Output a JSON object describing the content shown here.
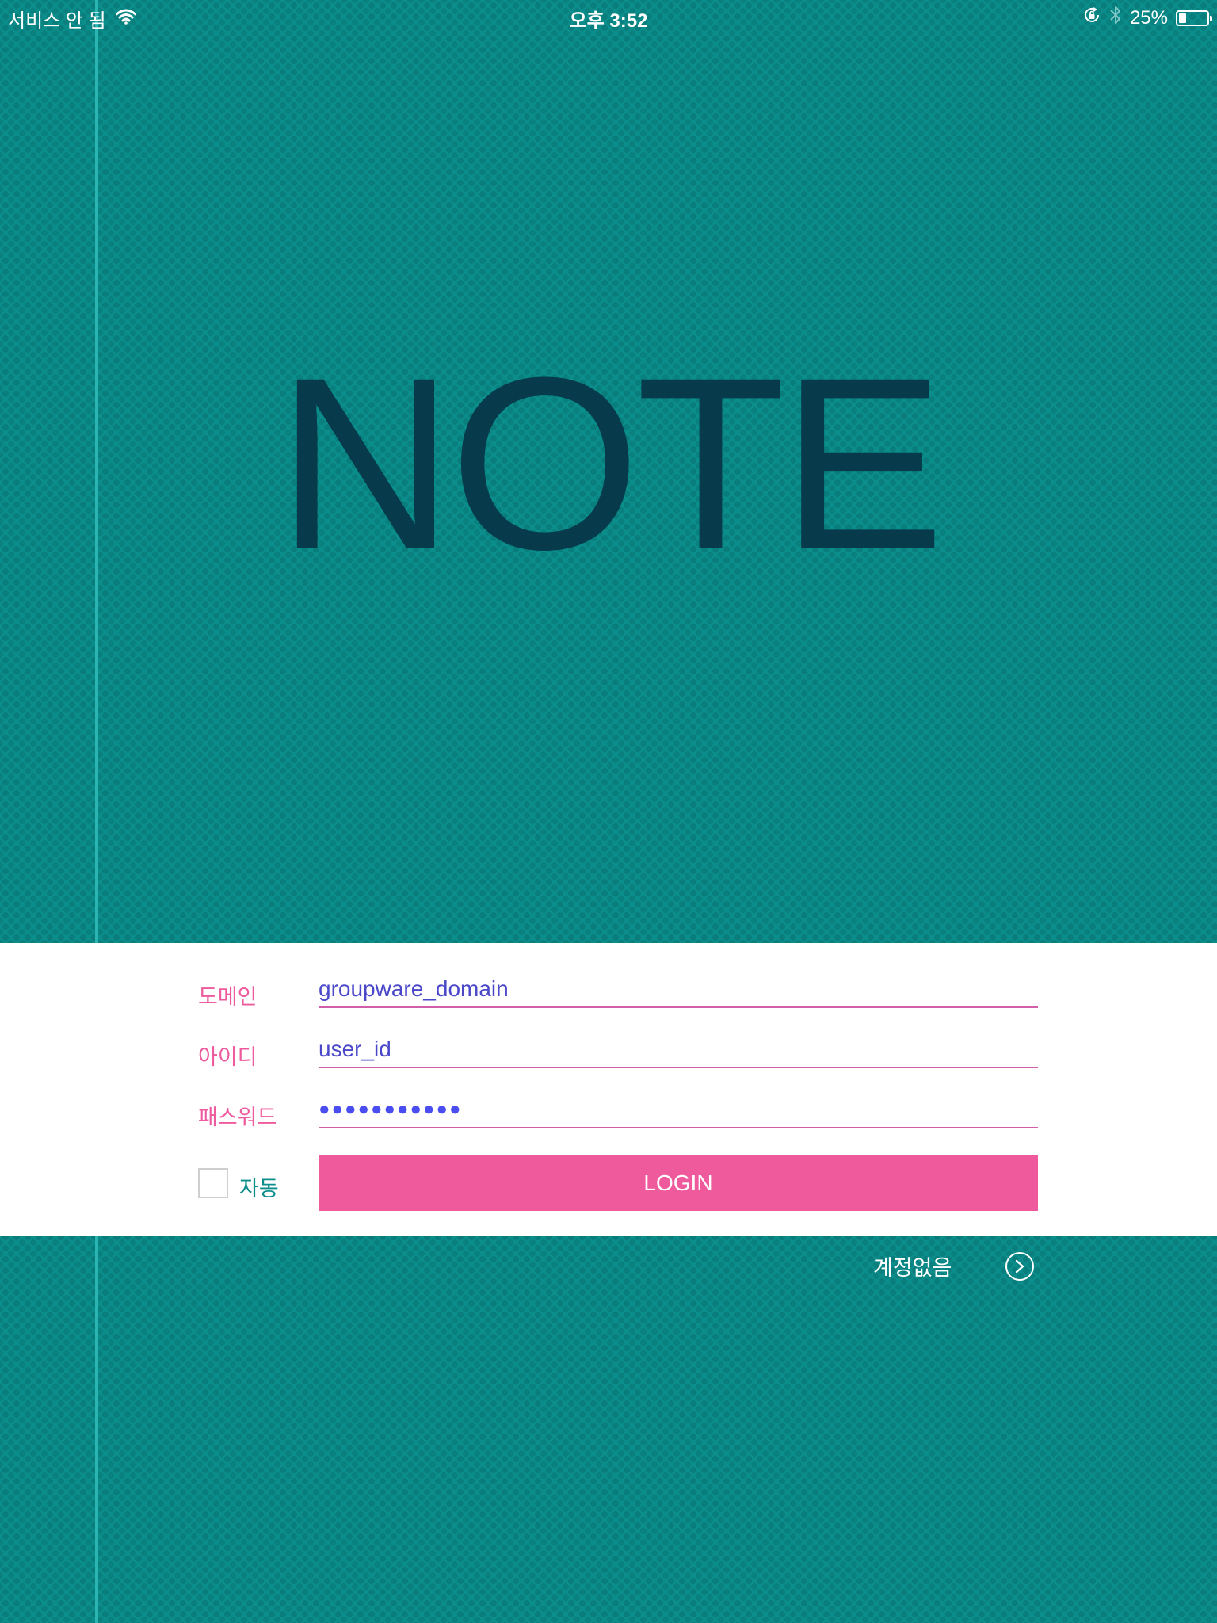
{
  "status_bar": {
    "carrier": "서비스 안 됨",
    "time": "오후 3:52",
    "battery_percent": "25%",
    "battery_level": 0.25,
    "icons": [
      "wifi-icon",
      "rotation-lock-icon",
      "bluetooth-icon",
      "battery-icon"
    ]
  },
  "logo": {
    "text": "NOTE"
  },
  "login": {
    "domain_label": "도메인",
    "domain_value": "groupware_domain",
    "id_label": "아이디",
    "id_value": "user_id",
    "password_label": "패스워드",
    "password_masked": "●●●●●●●●●●●",
    "auto_label": "자동",
    "auto_checked": false,
    "button_label": "LOGIN"
  },
  "footer": {
    "no_account_label": "계정없음",
    "arrow_icon": "chevron-right-circle-icon"
  },
  "colors": {
    "background": "#0b8d8b",
    "logo": "#073a4a",
    "accent_pink": "#ef5a9d",
    "input_text": "#4a48c9",
    "panel": "#ffffff"
  }
}
